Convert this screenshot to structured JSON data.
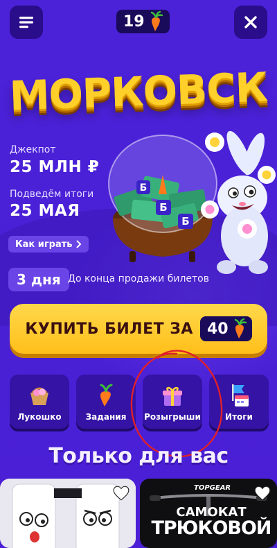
{
  "header": {
    "menu_icon": "hamburger-menu-icon",
    "close_icon": "close-icon",
    "carrot_balance": "19",
    "carrot_icon": "carrot-icon"
  },
  "lottery": {
    "title": "МОРКОВСК",
    "jackpot_label": "Джекпот",
    "jackpot_value": "25 МЛН ₽",
    "results_label": "Подведём итоги",
    "results_date": "25 МАЯ",
    "how_to_play": "Как играть",
    "days_left": "3 дня",
    "days_text": "До конца продажи билетов"
  },
  "buy": {
    "label": "КУПИТЬ БИЛЕТ ЗА",
    "price": "40"
  },
  "tiles": [
    {
      "label": "Лукошко",
      "icon": "basket-icon"
    },
    {
      "label": "Задания",
      "icon": "carrot-tasks-icon"
    },
    {
      "label": "Розыгрыши",
      "icon": "gift-icon"
    },
    {
      "label": "Итоги",
      "icon": "calendar-flag-icon"
    }
  ],
  "section_title": "Только для вас",
  "cards": {
    "right_brand": "TOPGEAR",
    "right_title_1": "САМОКАТ",
    "right_title_2": "ТРЮКОВОЙ"
  },
  "colors": {
    "background": "#4a1fd6",
    "accent_yellow": "#ffc928",
    "dark_pill": "#1a0a5a",
    "annotation_red": "#e0202a"
  }
}
